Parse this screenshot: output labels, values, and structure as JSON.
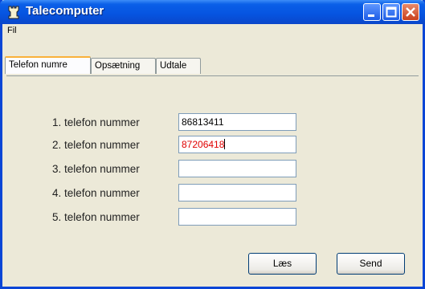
{
  "window": {
    "title": "Talecomputer"
  },
  "menu": {
    "file_label": "Fil"
  },
  "tabs": [
    {
      "label": "Telefon numre",
      "active": true
    },
    {
      "label": "Opsætning",
      "active": false
    },
    {
      "label": "Udtale",
      "active": false
    }
  ],
  "phones": [
    {
      "label": "1. telefon nummer",
      "value": "86813411"
    },
    {
      "label": "2. telefon nummer",
      "value": "87206418"
    },
    {
      "label": "3. telefon nummer",
      "value": ""
    },
    {
      "label": "4. telefon nummer",
      "value": ""
    },
    {
      "label": "5. telefon nummer",
      "value": ""
    }
  ],
  "buttons": {
    "read_label": "Læs",
    "send_label": "Send"
  },
  "colors": {
    "titlebar": "#0654e0",
    "highlight_text": "#e00000",
    "tab_accent": "#f9b13a"
  }
}
